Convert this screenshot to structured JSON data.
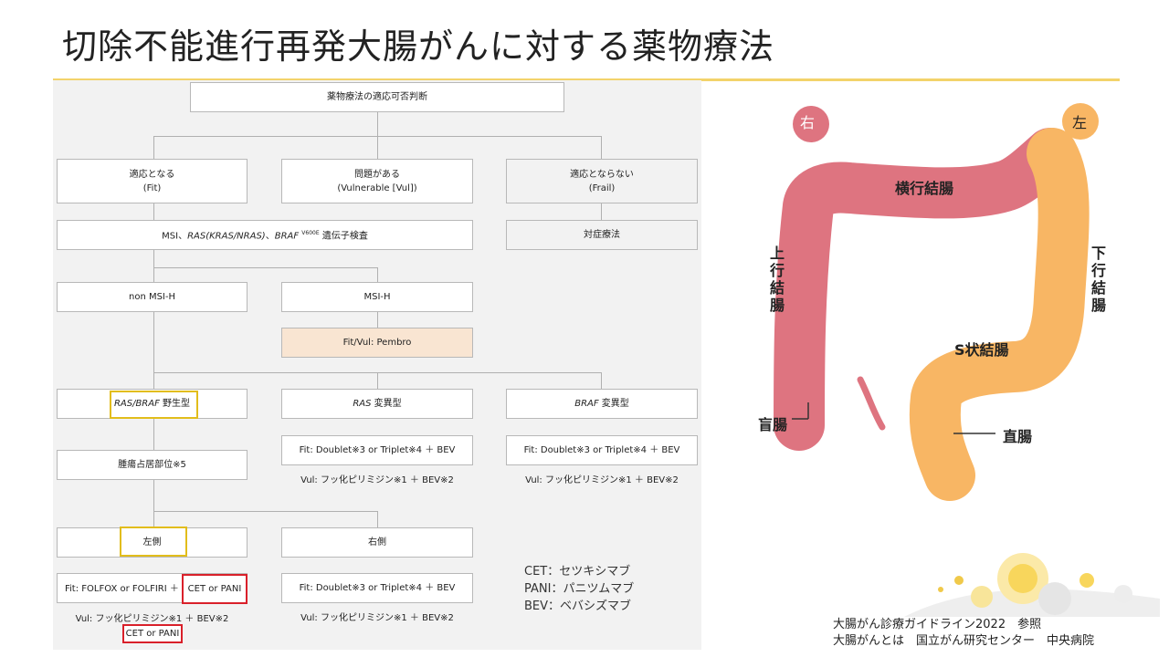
{
  "title": "切除不能進行再発大腸がんに対する薬物療法",
  "flow": {
    "root": "薬物療法の適応可否判断",
    "fit": {
      "line1": "適応となる",
      "line2": "(Fit)"
    },
    "vul": {
      "line1": "問題がある",
      "line2": "(Vulnerable [Vul])"
    },
    "frail": {
      "line1": "適応とならない",
      "line2": "(Frail)"
    },
    "genetic": {
      "a": "MSI、",
      "b": "RAS(KRAS/NRAS)",
      "c": "、",
      "d": "BRAF",
      "e": "V600E",
      "f": " 遺伝子検査"
    },
    "symptom": "対症療法",
    "non_msi": "non MSI-H",
    "msi": "MSI-H",
    "pembro": "Fit/Vul: Pembro",
    "ras_braf_wild": {
      "a": "RAS/BRAF",
      "b": " 野生型"
    },
    "ras_mut": {
      "a": "RAS",
      "b": " 変異型"
    },
    "braf_mut": {
      "a": "BRAF",
      "b": " 変異型"
    },
    "doublet_fit": "Fit: Doublet※3 or Triplet※4 ＋ BEV",
    "vul_fp": "Vul: フッ化ピリミジン※1 ＋ BEV※2",
    "tumor_site": "腫瘍占居部位※5",
    "left": "左側",
    "right": "右側",
    "left_fit": "Fit: FOLFOX or FOLFIRI ＋",
    "cet_pani": "CET or PANI",
    "left_vul": "Vul: フッ化ピリミジン※1 ＋ BEV※2"
  },
  "legend": [
    "CET：セツキシマブ",
    "PANI：パニツムマブ",
    "BEV：ベバシズマブ"
  ],
  "anatomy": {
    "right_badge": "右",
    "left_badge": "左",
    "transverse": "横行結腸",
    "ascending": "上行結腸",
    "descending": "下行結腸",
    "sigmoid": "S状結腸",
    "cecum": "盲腸",
    "rectum": "直腸"
  },
  "source": {
    "line1": "大腸がん診療ガイドライン2022　参照",
    "line2": "大腸がんとは　国立がん研究センター　中央病院"
  },
  "colors": {
    "accent_line": "#f3d36b",
    "right_colon": "#de7480",
    "left_colon": "#f8b664",
    "highlight_yellow": "#e2bd1b",
    "highlight_red": "#d9202a",
    "pembro_fill": "#f9e5d2"
  }
}
